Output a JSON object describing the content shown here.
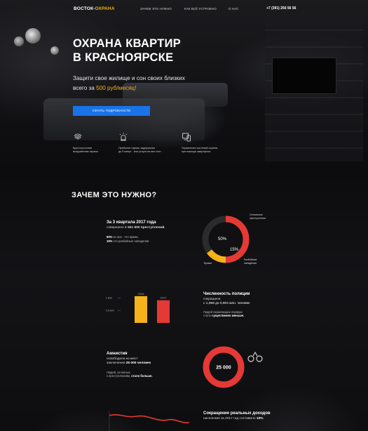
{
  "nav": {
    "logo_prefix": "ВОСТОК-",
    "logo_suffix": "ОХРАНА",
    "items": [
      "ЗАЧЕМ ЭТО НУЖНО",
      "КАК ВСЁ УСТРОЕНО",
      "О НАС"
    ],
    "phone": "+7 (391) 256 56 56"
  },
  "hero": {
    "title_line1": "ОХРАНА КВАРТИР",
    "title_line2": "В КРАСНОЯРСКЕ",
    "sub_line1": "Защити свое жилище и сон своих близких",
    "sub_prefix": "всего за ",
    "price": "500 руб/месяц!",
    "cta": "УЗНАТЬ ПОДРОБНОСТИ"
  },
  "features": [
    {
      "icon": "fingerprint-icon",
      "line1": "Круглосуточная",
      "line2": "вооруженная охрана"
    },
    {
      "icon": "alarm-siren-icon",
      "line1": "Прибытие группы задержания",
      "line2": "до 5 минут - или услуга на мес счет"
    },
    {
      "icon": "smartphone-control-icon",
      "line1": "Управление системой охраны",
      "line2": "при помощи смартфона"
    }
  ],
  "why": {
    "title": "ЗАЧЕМ ЭТО НУЖНО?"
  },
  "block1": {
    "heading": "За 3 квартала 2017 года",
    "sub_prefix": "совершено ",
    "sub_bold": "1 551 600 преступлений.",
    "l1_bold": "50%",
    "l1_rest": " из них - это кражи,",
    "l2_bold": "15%",
    "l2_rest": " это разбойные нападения."
  },
  "block2": {
    "heading": "Численность полиции",
    "l1": "сокращена",
    "l2": "с 1,068 до 0,904 млн. человек",
    "l3": "Людей охраняющих порядка",
    "l4_prefix": "стало ",
    "l4_bold": "существенно меньше."
  },
  "block3": {
    "heading": "Амнистия",
    "l1": "освободила из мест",
    "l2_prefix": "заключения ",
    "l2_bold": "25 000 человек",
    "l3": "Людей, склонных",
    "l4_prefix": "к преступлениям, ",
    "l4_bold": "стало больше."
  },
  "block4": {
    "heading": "Сокращение реальных доходов",
    "l1_prefix": "населения за 2017 год составило ",
    "l1_bold": "10%"
  },
  "amnesty_circle": {
    "value": "25 000",
    "icon": "handcuffs-icon"
  },
  "chart_data": [
    {
      "type": "pie",
      "labels": [
        "Кражи",
        "Разбойные нападения",
        "Остальные преступления"
      ],
      "values": [
        50,
        15,
        35
      ],
      "slice_labels": [
        "50%",
        "15%",
        ""
      ],
      "colors": [
        "#e53935",
        "#f5b21b",
        "#2b2b2b"
      ]
    },
    {
      "type": "bar",
      "categories": [
        "2016",
        "2017"
      ],
      "values": [
        1.068,
        0.904
      ],
      "ytick_labels": [
        "1 млн",
        "0,5 млн"
      ],
      "ytick_values": [
        1,
        0.5
      ],
      "ylim": [
        0,
        1.4
      ],
      "colors": [
        "#f5b21b",
        "#e53935"
      ]
    }
  ],
  "colors": {
    "accent": "#f5b21b",
    "red": "#e53935",
    "blue": "#1a73e8"
  }
}
